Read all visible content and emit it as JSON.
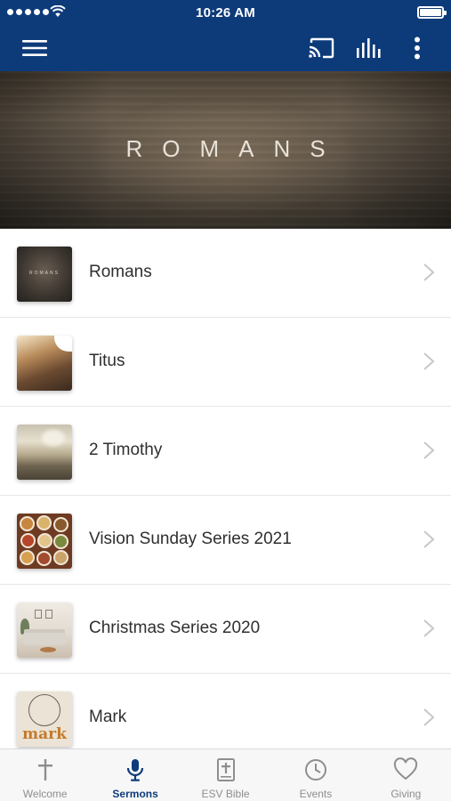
{
  "status_bar": {
    "time": "10:26 AM",
    "battery_level": 1.0
  },
  "nav": {
    "icons": [
      "menu-icon",
      "cast-icon",
      "audio-bars-icon",
      "more-vertical-icon"
    ]
  },
  "hero": {
    "title": "ROMANS"
  },
  "series": [
    {
      "title": "Romans",
      "thumb_text": "ROMANS"
    },
    {
      "title": "Titus"
    },
    {
      "title": "2 Timothy"
    },
    {
      "title": "Vision Sunday Series 2021"
    },
    {
      "title": "Christmas Series 2020"
    },
    {
      "title": "Mark",
      "thumb_text": "mark"
    }
  ],
  "tabs": [
    {
      "label": "Welcome",
      "icon": "cross-icon",
      "active": false
    },
    {
      "label": "Sermons",
      "icon": "microphone-icon",
      "active": true
    },
    {
      "label": "ESV Bible",
      "icon": "bible-icon",
      "active": false
    },
    {
      "label": "Events",
      "icon": "clock-icon",
      "active": false
    },
    {
      "label": "Giving",
      "icon": "heart-icon",
      "active": false
    }
  ],
  "colors": {
    "primary": "#0d3b7a",
    "inactive_tab": "#8e8e8e",
    "chevron": "#c7c7cc"
  }
}
